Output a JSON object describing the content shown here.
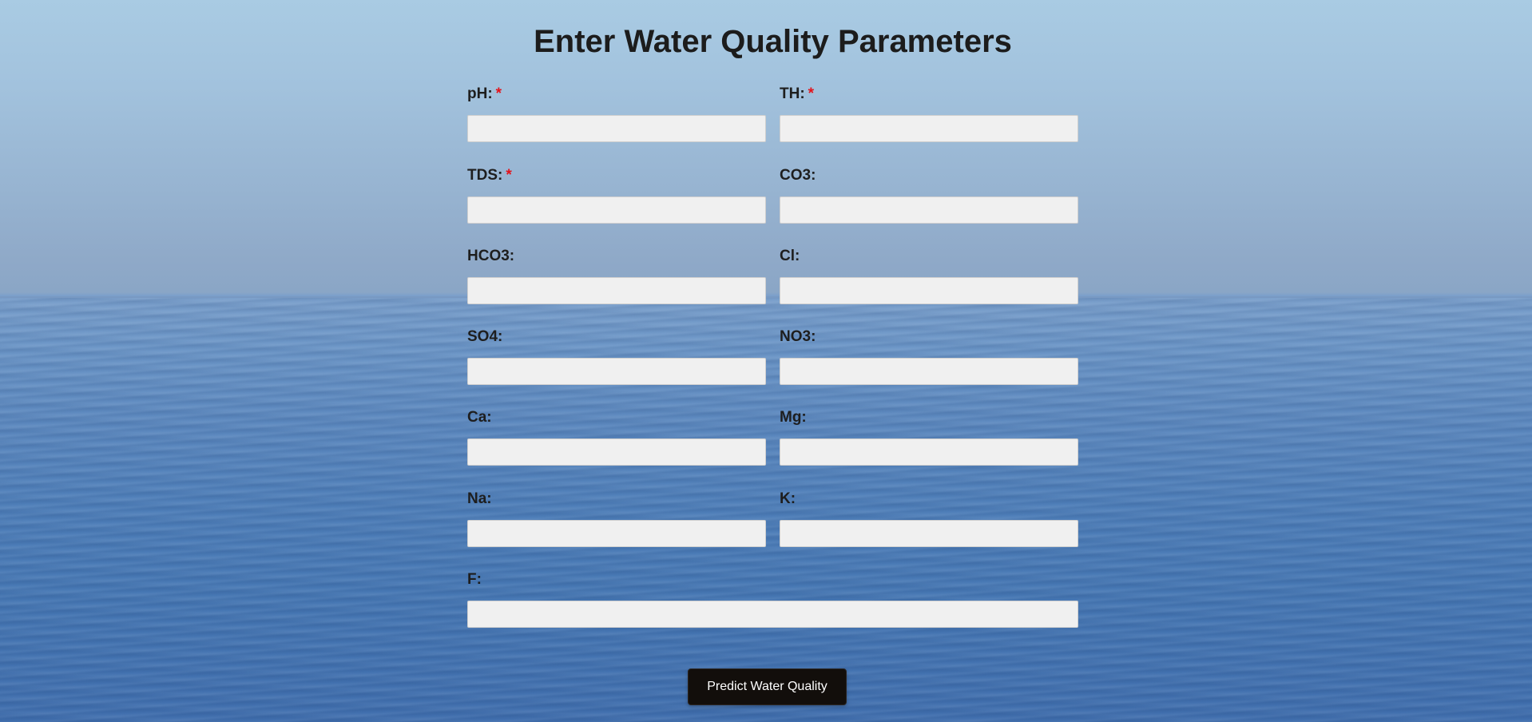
{
  "page": {
    "title": "Enter Water Quality Parameters"
  },
  "form": {
    "required_marker": "*",
    "fields": [
      {
        "label": "pH:",
        "required": true,
        "value": "",
        "placeholder": ""
      },
      {
        "label": "TH:",
        "required": true,
        "value": "",
        "placeholder": ""
      },
      {
        "label": "TDS:",
        "required": true,
        "value": "",
        "placeholder": ""
      },
      {
        "label": "CO3:",
        "required": false,
        "value": "",
        "placeholder": ""
      },
      {
        "label": "HCO3:",
        "required": false,
        "value": "",
        "placeholder": ""
      },
      {
        "label": "Cl:",
        "required": false,
        "value": "",
        "placeholder": ""
      },
      {
        "label": "SO4:",
        "required": false,
        "value": "",
        "placeholder": ""
      },
      {
        "label": "NO3:",
        "required": false,
        "value": "",
        "placeholder": ""
      },
      {
        "label": "Ca:",
        "required": false,
        "value": "",
        "placeholder": ""
      },
      {
        "label": "Mg:",
        "required": false,
        "value": "",
        "placeholder": ""
      },
      {
        "label": "Na:",
        "required": false,
        "value": "",
        "placeholder": ""
      },
      {
        "label": "K:",
        "required": false,
        "value": "",
        "placeholder": ""
      },
      {
        "label": "F:",
        "required": false,
        "value": "",
        "placeholder": ""
      }
    ],
    "submit_label": "Predict Water Quality"
  },
  "colors": {
    "required_marker": "#e3131b",
    "button_background": "#120e0b",
    "input_background": "#f0f0f0"
  }
}
